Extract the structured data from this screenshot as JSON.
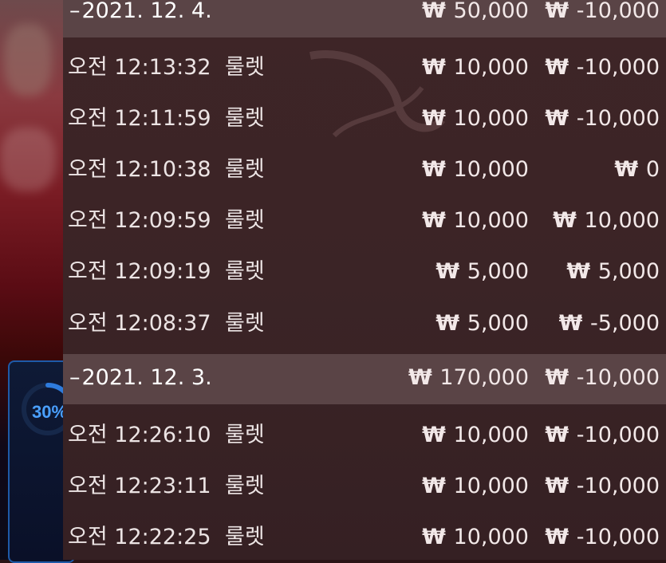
{
  "currency_symbol": "₩",
  "progress_widget": {
    "label": "30%",
    "percent": 30
  },
  "groups": [
    {
      "date": "2021. 12. 4.",
      "total_bet": "50,000",
      "total_net": "-10,000",
      "rows": [
        {
          "time": "오전 12:13:32",
          "game": "룰렛",
          "bet": "10,000",
          "net": "-10,000"
        },
        {
          "time": "오전 12:11:59",
          "game": "룰렛",
          "bet": "10,000",
          "net": "-10,000"
        },
        {
          "time": "오전 12:10:38",
          "game": "룰렛",
          "bet": "10,000",
          "net": "0"
        },
        {
          "time": "오전 12:09:59",
          "game": "룰렛",
          "bet": "10,000",
          "net": "10,000"
        },
        {
          "time": "오전 12:09:19",
          "game": "룰렛",
          "bet": "5,000",
          "net": "5,000"
        },
        {
          "time": "오전 12:08:37",
          "game": "룰렛",
          "bet": "5,000",
          "net": "-5,000"
        }
      ]
    },
    {
      "date": "2021. 12. 3.",
      "total_bet": "170,000",
      "total_net": "-10,000",
      "rows": [
        {
          "time": "오전 12:26:10",
          "game": "룰렛",
          "bet": "10,000",
          "net": "-10,000"
        },
        {
          "time": "오전 12:23:11",
          "game": "룰렛",
          "bet": "10,000",
          "net": "-10,000"
        },
        {
          "time": "오전 12:22:25",
          "game": "룰렛",
          "bet": "10,000",
          "net": "-10,000"
        }
      ]
    }
  ]
}
